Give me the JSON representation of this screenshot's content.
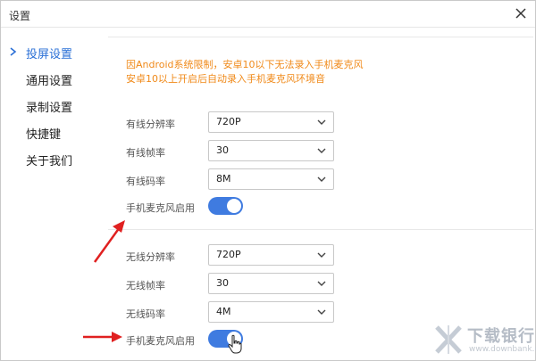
{
  "window": {
    "title": "设置"
  },
  "sidebar": {
    "items": [
      {
        "label": "投屏设置",
        "active": true
      },
      {
        "label": "通用设置",
        "active": false
      },
      {
        "label": "录制设置",
        "active": false
      },
      {
        "label": "快捷键",
        "active": false
      },
      {
        "label": "关于我们",
        "active": false
      }
    ]
  },
  "notice": {
    "line1": "因Android系统限制，安卓10以下无法录入手机麦克风",
    "line2": "安卓10以上开启后自动录入手机麦克风环境音"
  },
  "wired": {
    "resolution": {
      "label": "有线分辨率",
      "value": "720P"
    },
    "framerate": {
      "label": "有线帧率",
      "value": "30"
    },
    "bitrate": {
      "label": "有线码率",
      "value": "8M"
    },
    "mic": {
      "label": "手机麦克风启用",
      "enabled": true
    }
  },
  "wireless": {
    "resolution": {
      "label": "无线分辨率",
      "value": "720P"
    },
    "framerate": {
      "label": "无线帧率",
      "value": "30"
    },
    "bitrate": {
      "label": "无线码率",
      "value": "4M"
    },
    "mic": {
      "label": "手机麦克风启用",
      "enabled": true
    }
  },
  "watermark": {
    "title": "下载银行",
    "sub": "www.downbank.cn"
  },
  "colors": {
    "accent": "#3f7be0",
    "notice": "#f08a1a",
    "annotation": "#e02020",
    "active_nav": "#2a6fd6"
  }
}
